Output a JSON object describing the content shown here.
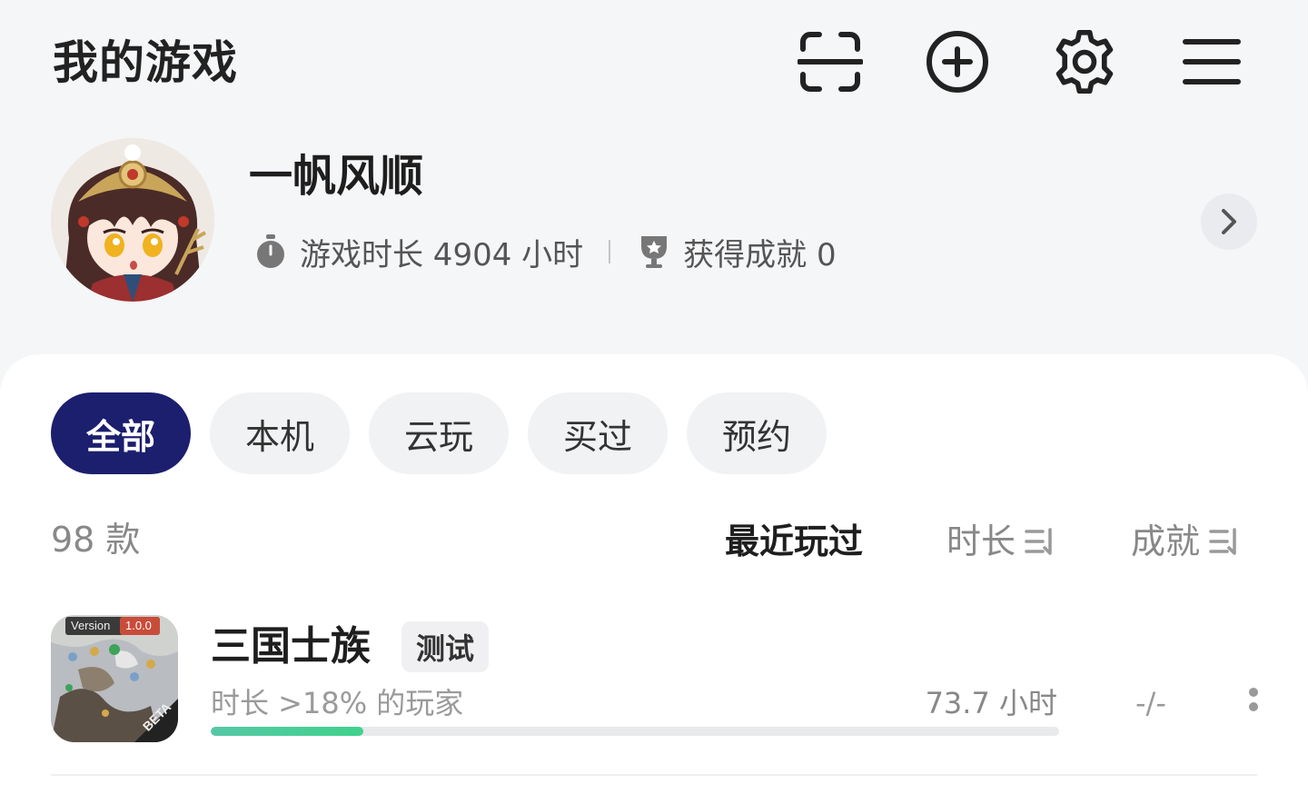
{
  "header": {
    "title": "我的游戏",
    "icons": [
      "scan-icon",
      "add-circle-icon",
      "gear-icon",
      "menu-icon"
    ]
  },
  "profile": {
    "username": "一帆风顺",
    "playtime_label": "游戏时长 4904 小时",
    "achievements_label": "获得成就 0"
  },
  "tabs": [
    {
      "label": "全部",
      "active": true
    },
    {
      "label": "本机",
      "active": false
    },
    {
      "label": "云玩",
      "active": false
    },
    {
      "label": "买过",
      "active": false
    },
    {
      "label": "预约",
      "active": false
    }
  ],
  "list": {
    "count_label": "98 款",
    "sort": {
      "recent": "最近玩过",
      "duration": "时长",
      "achievements": "成就"
    }
  },
  "games": [
    {
      "name": "三国士族",
      "tag": "测试",
      "sub": "时长 >18% 的玩家",
      "hours": "73.7 小时",
      "achievements": "-/-",
      "icon_text": {
        "version_label": "Version",
        "version_number": "1.0.0",
        "beta": "BETA"
      },
      "progress": 0.18
    }
  ],
  "colors": {
    "accent": "#1b1f6e",
    "progress": "#4fcb98",
    "background": "#f5f6f8"
  }
}
